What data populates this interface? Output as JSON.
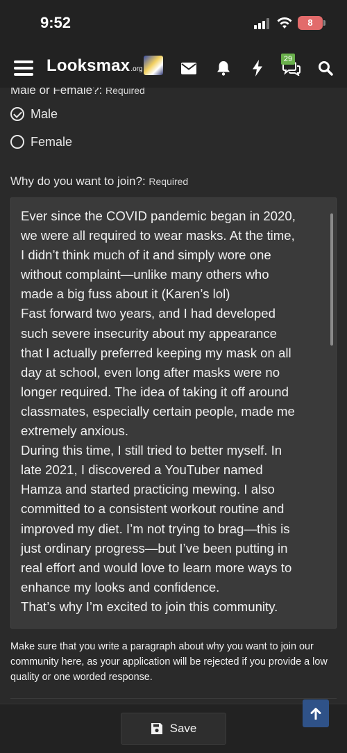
{
  "status_bar": {
    "time": "9:52",
    "battery": "8"
  },
  "nav": {
    "logo_main": "Looksmax",
    "logo_tld": ".org",
    "icons": [
      "menu-icon",
      "avatar",
      "mail-icon",
      "bell-icon",
      "bolt-icon",
      "chat-icon",
      "search-icon"
    ],
    "chat_badge": "29"
  },
  "form": {
    "q1_label": "Male or Female?:",
    "q1_required": "Required",
    "options": [
      {
        "label": "Male",
        "checked": true
      },
      {
        "label": "Female",
        "checked": false
      }
    ],
    "q2_label": "Why do you want to join?:",
    "q2_required": "Required",
    "answer": "Ever since the COVID pandemic began in 2020,\nwe were all required to wear masks. At the time,\nI didn’t think much of it and simply wore one\nwithout complaint—unlike many others who\nmade a big fuss about it (Karen’s lol)\nFast forward two years, and I had developed\nsuch severe insecurity about my appearance\nthat I actually preferred keeping my mask on all\nday at school, even long after masks were no\nlonger required. The idea of taking it off around\nclassmates, especially certain people, made me\nextremely anxious.\nDuring this time, I still tried to better myself. In\nlate 2021, I discovered a YouTuber named\nHamza and started practicing mewing. I also\ncommitted to a consistent workout routine and\nimproved my diet. I’m not trying to brag—this is\njust ordinary progress—but I’ve been putting in\nreal effort and would love to learn more ways to\nenhance my looks and confidence.\nThat’s why I’m excited to join this community.",
    "hint": "Make sure that you write a paragraph about why you want to join our community here, as your application will be rejected if you provide a low quality or one worded response."
  },
  "footer": {
    "save_label": "Save"
  },
  "colors": {
    "page_bg": "#2a2a2a",
    "bar_bg": "#222222",
    "textarea_bg": "#3a3a3a",
    "badge_green": "#6ab04c",
    "scroll_top_blue": "#2f5288",
    "battery_red": "#e26b6b"
  }
}
